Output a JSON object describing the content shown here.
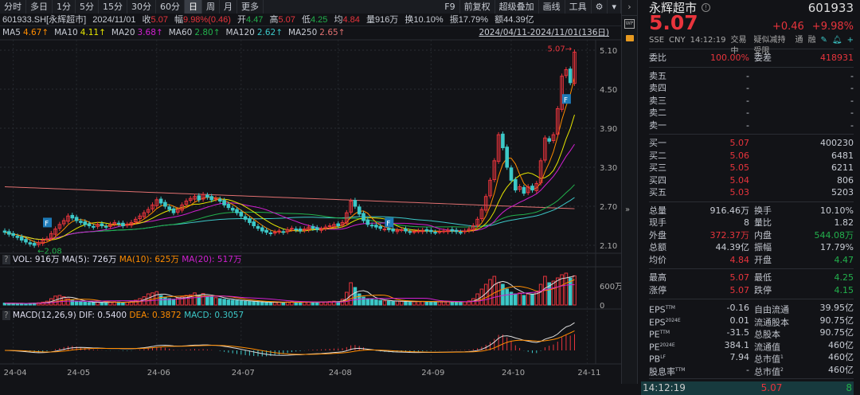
{
  "toolbar": {
    "left": [
      "分时",
      "多日",
      "1分",
      "5分",
      "15分",
      "30分",
      "60分",
      "日",
      "周",
      "月",
      "更多"
    ],
    "active": "日",
    "right": [
      "F9",
      "前复权",
      "超级叠加",
      "画线",
      "工具"
    ],
    "settings_icon": "gear-icon"
  },
  "info": {
    "code": "601933.SH[永辉超市]",
    "date": "2024/11/01",
    "close_label": "收",
    "close": "5.07",
    "change_label": "幅",
    "change": "9.98%(0.46)",
    "open_label": "开",
    "open": "4.47",
    "high_label": "高",
    "high": "5.07",
    "low_label": "低",
    "low": "4.25",
    "avg_label": "均",
    "avg": "4.84",
    "vol_label": "量",
    "vol": "916万",
    "turnover_label": "换",
    "turnover": "10.10%",
    "amp_label": "振",
    "amp": "17.79%",
    "amount_label": "额",
    "amount": "44.39亿"
  },
  "ma": {
    "items": [
      {
        "label": "MA5",
        "value": "4.67↑",
        "color": "#ff8c00"
      },
      {
        "label": "MA10",
        "value": "4.11↑",
        "color": "#e6e600"
      },
      {
        "label": "MA20",
        "value": "3.68↑",
        "color": "#d020d0"
      },
      {
        "label": "MA60",
        "value": "2.80↑",
        "color": "#22b14c"
      },
      {
        "label": "MA120",
        "value": "2.62↑",
        "color": "#3cc8c8"
      },
      {
        "label": "MA250",
        "value": "2.65↑",
        "color": "#e07070"
      }
    ],
    "range": "2024/04/11-2024/11/01(136日)"
  },
  "vol_header": {
    "q": "?",
    "vol": "VOL: 916万",
    "ma5": "MA(5): 726万",
    "ma10": "MA(10): 625万",
    "ma20": "MA(20): 517万"
  },
  "macd_header": {
    "q": "?",
    "title": "MACD(12,26,9)",
    "dif": "DIF: 0.5400",
    "dea": "DEA: 0.3872",
    "macd": "MACD: 0.3057"
  },
  "chart_data": {
    "type": "candlestick",
    "price_ticks": [
      "5.10",
      "4.50",
      "3.90",
      "3.30",
      "2.70",
      "2.10"
    ],
    "price_range": [
      2.1,
      5.1
    ],
    "vol_ticks": [
      "600万",
      "0"
    ],
    "x_ticks": [
      {
        "label": "24-04",
        "i": 2
      },
      {
        "label": "24-05",
        "i": 17
      },
      {
        "label": "24-06",
        "i": 36
      },
      {
        "label": "24-07",
        "i": 56
      },
      {
        "label": "24-08",
        "i": 79
      },
      {
        "label": "24-09",
        "i": 101
      },
      {
        "label": "24-10",
        "i": 120
      },
      {
        "label": "24-11",
        "i": 138
      }
    ],
    "high_label": "5.07",
    "low_label": "2.08",
    "low_index": 7,
    "closes": [
      2.3,
      2.27,
      2.25,
      2.22,
      2.18,
      2.15,
      2.12,
      2.1,
      2.14,
      2.18,
      2.2,
      2.28,
      2.35,
      2.42,
      2.48,
      2.55,
      2.52,
      2.48,
      2.45,
      2.42,
      2.4,
      2.38,
      2.42,
      2.4,
      2.38,
      2.42,
      2.45,
      2.43,
      2.4,
      2.42,
      2.45,
      2.5,
      2.55,
      2.6,
      2.65,
      2.72,
      2.8,
      2.75,
      2.7,
      2.65,
      2.6,
      2.65,
      2.72,
      2.78,
      2.82,
      2.85,
      2.8,
      2.88,
      2.84,
      2.8,
      2.82,
      2.78,
      2.72,
      2.68,
      2.64,
      2.6,
      2.55,
      2.5,
      2.45,
      2.4,
      2.36,
      2.32,
      2.3,
      2.28,
      2.3,
      2.32,
      2.3,
      2.34,
      2.36,
      2.34,
      2.32,
      2.35,
      2.38,
      2.36,
      2.34,
      2.35,
      2.38,
      2.4,
      2.42,
      2.4,
      2.45,
      2.6,
      2.78,
      2.7,
      2.58,
      2.48,
      2.42,
      2.4,
      2.38,
      2.36,
      2.35,
      2.34,
      2.32,
      2.33,
      2.34,
      2.32,
      2.3,
      2.31,
      2.32,
      2.33,
      2.32,
      2.31,
      2.3,
      2.31,
      2.32,
      2.33,
      2.32,
      2.31,
      2.3,
      2.32,
      2.35,
      2.4,
      2.5,
      2.65,
      2.85,
      3.1,
      3.4,
      3.8,
      3.6,
      3.3,
      3.1,
      2.95,
      3.0,
      2.9,
      3.0,
      2.95,
      3.05,
      3.4,
      3.75,
      3.7,
      3.8,
      4.2,
      4.7,
      4.8,
      4.6,
      5.07
    ],
    "volumes": [
      60,
      55,
      50,
      48,
      45,
      50,
      55,
      60,
      70,
      90,
      120,
      200,
      280,
      300,
      260,
      200,
      150,
      120,
      100,
      90,
      80,
      85,
      90,
      80,
      75,
      90,
      100,
      95,
      85,
      90,
      110,
      150,
      200,
      260,
      350,
      380,
      420,
      300,
      250,
      200,
      180,
      220,
      260,
      300,
      320,
      380,
      300,
      360,
      280,
      250,
      230,
      200,
      180,
      160,
      150,
      140,
      130,
      120,
      110,
      100,
      90,
      85,
      80,
      80,
      85,
      90,
      80,
      95,
      100,
      90,
      85,
      90,
      100,
      95,
      90,
      95,
      100,
      110,
      120,
      110,
      180,
      400,
      700,
      550,
      350,
      250,
      200,
      180,
      160,
      140,
      130,
      120,
      110,
      120,
      115,
      110,
      100,
      105,
      110,
      115,
      110,
      100,
      95,
      100,
      105,
      110,
      100,
      95,
      90,
      100,
      130,
      200,
      350,
      500,
      650,
      800,
      900,
      700,
      650,
      500,
      400,
      350,
      380,
      300,
      350,
      330,
      400,
      650,
      900,
      700,
      750,
      850,
      950,
      1000,
      850,
      916
    ]
  },
  "side": {
    "expand_icon": "chevron-right-icon",
    "wp_icon": "wp-monitor-icon",
    "lock_icon": "unlock-icon",
    "collapse_icon": "double-chevron-icon"
  },
  "quote": {
    "name": "永辉超市",
    "code": "601933",
    "price": "5.07",
    "change": "+0.46",
    "pct": "+9.98%",
    "meta": [
      "SSE",
      "CNY",
      "14:12:19",
      "交易中",
      "疑似减持受限",
      "通",
      "融"
    ],
    "weibi": {
      "label": "委比",
      "value": "100.00%",
      "label2": "委差",
      "value2": "418931"
    },
    "asks": [
      {
        "label": "卖五",
        "price": "-",
        "vol": "-"
      },
      {
        "label": "卖四",
        "price": "-",
        "vol": "-"
      },
      {
        "label": "卖三",
        "price": "-",
        "vol": "-"
      },
      {
        "label": "卖二",
        "price": "-",
        "vol": "-"
      },
      {
        "label": "卖一",
        "price": "-",
        "vol": "-"
      }
    ],
    "bids": [
      {
        "label": "买一",
        "price": "5.07",
        "vol": "400230"
      },
      {
        "label": "买二",
        "price": "5.06",
        "vol": "6481"
      },
      {
        "label": "买三",
        "price": "5.05",
        "vol": "6211"
      },
      {
        "label": "买四",
        "price": "5.04",
        "vol": "806"
      },
      {
        "label": "买五",
        "price": "5.03",
        "vol": "5203"
      }
    ],
    "stats": [
      {
        "l": "总量",
        "v": "916.46万",
        "c": "",
        "l2": "换手",
        "v2": "10.10%",
        "c2": ""
      },
      {
        "l": "现手",
        "v": "8",
        "c": "",
        "l2": "量比",
        "v2": "1.82",
        "c2": ""
      },
      {
        "l": "外盘",
        "v": "372.37万",
        "c": "red",
        "l2": "内盘",
        "v2": "544.08万",
        "c2": "green"
      },
      {
        "l": "总额",
        "v": "44.39亿",
        "c": "",
        "l2": "振幅",
        "v2": "17.79%",
        "c2": ""
      },
      {
        "l": "均价",
        "v": "4.84",
        "c": "red",
        "l2": "开盘",
        "v2": "4.47",
        "c2": "green"
      },
      {
        "l": "最高",
        "v": "5.07",
        "c": "red",
        "l2": "最低",
        "v2": "4.25",
        "c2": "green"
      },
      {
        "l": "涨停",
        "v": "5.07",
        "c": "red",
        "l2": "跌停",
        "v2": "4.15",
        "c2": "green"
      }
    ],
    "fund": [
      {
        "l": "EPS",
        "s": "TTM",
        "v": "-0.16",
        "l2": "自由流通",
        "s2": "",
        "v2": "39.95亿"
      },
      {
        "l": "EPS",
        "s": "2024E",
        "v": "0.01",
        "l2": "流通股本",
        "s2": "",
        "v2": "90.75亿"
      },
      {
        "l": "PE",
        "s": "TTM",
        "v": "-31.5",
        "l2": "总股本",
        "s2": "",
        "v2": "90.75亿"
      },
      {
        "l": "PE",
        "s": "2024E",
        "v": "384.1",
        "l2": "流通值",
        "s2": "",
        "v2": "460亿"
      },
      {
        "l": "PB",
        "s": "LF",
        "v": "7.94",
        "l2": "总市值",
        "s2": "1",
        "v2": "460亿"
      },
      {
        "l": "股息率",
        "s": "TTM",
        "v": "-",
        "l2": "总市值",
        "s2": "2",
        "v2": "460亿"
      }
    ],
    "tick": {
      "time": "14:12:19",
      "price": "5.07",
      "vol": "8"
    }
  },
  "colors": {
    "up": "#e8343c",
    "down": "#3cc8c8",
    "bg": "#121317"
  }
}
